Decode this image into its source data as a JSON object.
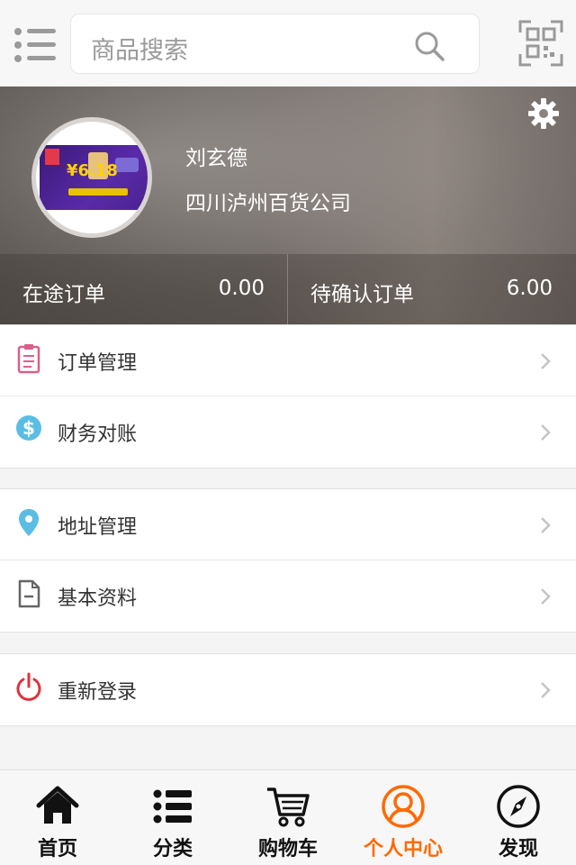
{
  "header": {
    "search_placeholder": "商品搜索"
  },
  "profile": {
    "name": "刘玄德",
    "company": "四川泸州百货公司",
    "avatar_text": "¥6.18"
  },
  "stats": [
    {
      "label": "在途订单",
      "value": "0.00"
    },
    {
      "label": "待确认订单",
      "value": "6.00"
    }
  ],
  "menu_groups": [
    [
      {
        "label": "订单管理",
        "icon": "clipboard-icon",
        "color": "#d9608c"
      },
      {
        "label": "财务对账",
        "icon": "dollar-coin-icon",
        "color": "#5bbde3"
      }
    ],
    [
      {
        "label": "地址管理",
        "icon": "location-pin-icon",
        "color": "#5bbde3"
      },
      {
        "label": "基本资料",
        "icon": "document-icon",
        "color": "#666666"
      }
    ],
    [
      {
        "label": "重新登录",
        "icon": "power-icon",
        "color": "#e0323a"
      }
    ]
  ],
  "tabs": [
    {
      "label": "首页",
      "icon": "home-icon",
      "active": false
    },
    {
      "label": "分类",
      "icon": "list-icon",
      "active": false
    },
    {
      "label": "购物车",
      "icon": "cart-icon",
      "active": false
    },
    {
      "label": "个人中心",
      "icon": "user-icon",
      "active": true
    },
    {
      "label": "发现",
      "icon": "compass-icon",
      "active": false
    }
  ],
  "colors": {
    "accent": "#ff6a00",
    "text": "#333333"
  }
}
